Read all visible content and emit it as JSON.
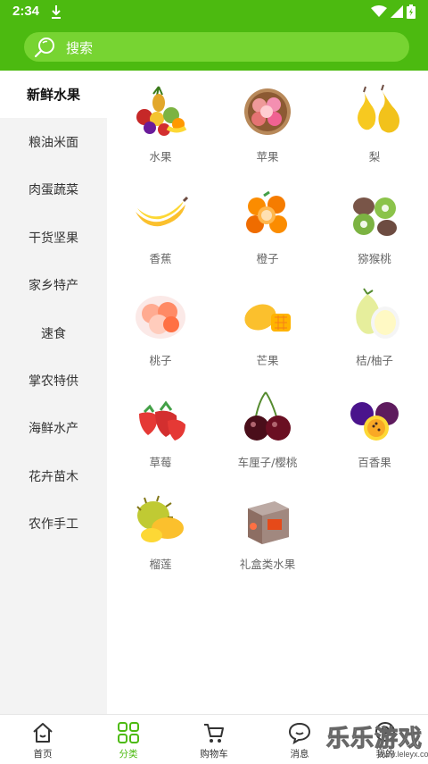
{
  "status_bar": {
    "time": "2:34",
    "icons": [
      "download-icon",
      "wifi-icon",
      "signal-icon",
      "battery-icon"
    ]
  },
  "search": {
    "placeholder": "搜索"
  },
  "sidebar": {
    "items": [
      {
        "label": "新鲜水果",
        "active": true
      },
      {
        "label": "粮油米面"
      },
      {
        "label": "肉蛋蔬菜"
      },
      {
        "label": "干货坚果"
      },
      {
        "label": "家乡特产"
      },
      {
        "label": "速食"
      },
      {
        "label": "掌农特供"
      },
      {
        "label": "海鲜水产"
      },
      {
        "label": "花卉苗木"
      },
      {
        "label": "农作手工"
      }
    ]
  },
  "categories": [
    {
      "label": "水果",
      "icon": "fruit-basket-icon"
    },
    {
      "label": "苹果",
      "icon": "apple-icon"
    },
    {
      "label": "梨",
      "icon": "pear-icon"
    },
    {
      "label": "香蕉",
      "icon": "banana-icon"
    },
    {
      "label": "橙子",
      "icon": "orange-icon"
    },
    {
      "label": "猕猴桃",
      "icon": "kiwi-icon"
    },
    {
      "label": "桃子",
      "icon": "peach-icon"
    },
    {
      "label": "芒果",
      "icon": "mango-icon"
    },
    {
      "label": "桔/柚子",
      "icon": "pomelo-icon"
    },
    {
      "label": "草莓",
      "icon": "strawberry-icon"
    },
    {
      "label": "车厘子/樱桃",
      "icon": "cherry-icon"
    },
    {
      "label": "百香果",
      "icon": "passion-fruit-icon"
    },
    {
      "label": "榴莲",
      "icon": "durian-icon"
    },
    {
      "label": "礼盒类水果",
      "icon": "gift-box-icon"
    }
  ],
  "tabbar": {
    "items": [
      {
        "label": "首页",
        "icon": "home-icon"
      },
      {
        "label": "分类",
        "icon": "category-icon",
        "active": true
      },
      {
        "label": "购物车",
        "icon": "cart-icon"
      },
      {
        "label": "消息",
        "icon": "message-icon"
      },
      {
        "label": "我的",
        "icon": "user-icon"
      }
    ]
  },
  "watermark": {
    "text": "乐乐游戏",
    "url": "www.leleyx.com"
  },
  "colors": {
    "brand": "#4cba10",
    "search_bg": "#77d432",
    "sidebar_bg": "#f3f3f3",
    "label": "#666666"
  }
}
